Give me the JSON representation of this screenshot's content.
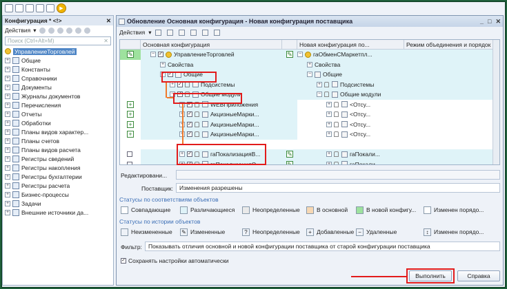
{
  "config_panel": {
    "title": "Конфигурация * <!>",
    "close": "✕",
    "actions": "Действия",
    "search_placeholder": "Поиск (Ctrl+Alt+M)",
    "root": "УправлениеТорговлей",
    "items": [
      "Общие",
      "Константы",
      "Справочники",
      "Документы",
      "Журналы документов",
      "Перечисления",
      "Отчеты",
      "Обработки",
      "Планы видов характер...",
      "Планы счетов",
      "Планы видов расчета",
      "Регистры сведений",
      "Регистры накопления",
      "Регистры бухгалтерии",
      "Регистры расчета",
      "Бизнес-процессы",
      "Задачи",
      "Внешние источники да..."
    ]
  },
  "window": {
    "title": "Обновление Основная конфигурация - Новая конфигурация поставщика",
    "actions": "Действия",
    "columns": {
      "main": "Основная конфигурация",
      "new": "Новая конфигурация по...",
      "mode": "Режим объединения и порядок по..."
    },
    "rows": [
      {
        "main": "УправлениеТорговлей",
        "new": "гаОбменСМаркетпл..."
      },
      {
        "main": "Свойства",
        "new": "Свойства"
      },
      {
        "main": "Общие",
        "new": "Общие"
      },
      {
        "main": "Подсистемы",
        "new": "Подсистемы"
      },
      {
        "main": "Общие модули",
        "new": "Общие модули"
      },
      {
        "main": "WEBПриложения",
        "new": "<Отсу..."
      },
      {
        "main": "АкцизныеМарки...",
        "new": "<Отсу..."
      },
      {
        "main": "АкцизныеМарки...",
        "new": "<Отсу..."
      },
      {
        "main": "АкцизныеМарки...",
        "new": "<Отсу..."
      },
      {
        "main": "",
        "new": ""
      },
      {
        "main": "гаПокализацияВ...",
        "new": "гаПокали..."
      },
      {
        "main": "гаПокализацияО...",
        "new": "гаПокали..."
      }
    ],
    "edit_label": "Редактировани...",
    "supplier_label": "Поставщик:",
    "supplier_value": "Изменения разрешены",
    "status_obj_title": "Статусы по соответствиям объектов",
    "status_obj": [
      {
        "label": "Совпадающие",
        "color": "#ffffff"
      },
      {
        "label": "Различающиеся",
        "color": "#dff3f8"
      },
      {
        "label": "Неопределенные",
        "color": "#eaeaea"
      },
      {
        "label": "В основной",
        "color": "#f7d8b4"
      },
      {
        "label": "В новой конфигу...",
        "color": "#9ee29e"
      },
      {
        "label": "Изменен порядо...",
        "color": "#ffffff"
      }
    ],
    "status_hist_title": "Статусы по истории объектов",
    "status_hist": [
      "Неизмененные",
      "Измененные",
      "Неопределенные",
      "Добавленные",
      "Удаленные",
      "Изменен порядо..."
    ],
    "filter_label": "Фильтр:",
    "filter_value": "Показывать отличия основной и новой конфигурации поставщика от старой конфигурации поставщика",
    "save_settings": "Сохранять настройки автоматически",
    "execute": "Выполнить",
    "help": "Справка"
  }
}
